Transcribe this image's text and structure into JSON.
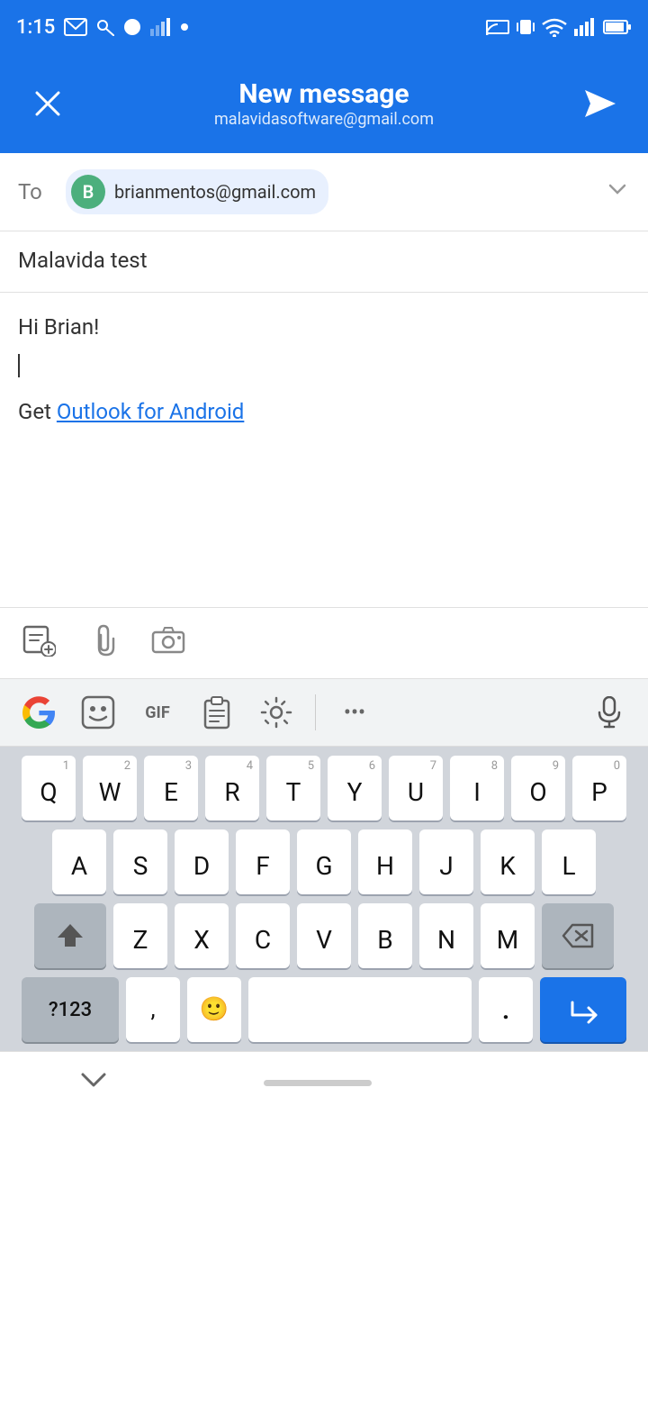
{
  "statusBar": {
    "time": "1:15",
    "icons": [
      "mail",
      "key",
      "circle",
      "signal",
      "dot",
      "cast",
      "vibrate",
      "wifi",
      "signal-bars",
      "battery"
    ]
  },
  "header": {
    "title": "New message",
    "subtitle": "malavidasoftware@gmail.com",
    "closeLabel": "×",
    "sendLabel": "➤"
  },
  "toField": {
    "label": "To",
    "recipientInitial": "B",
    "recipientEmail": "brianmentos@gmail.com"
  },
  "subject": {
    "text": "Malavida test"
  },
  "body": {
    "greeting": "Hi Brian!",
    "signaturePrefix": "Get ",
    "signatureLink": "Outlook for Android"
  },
  "toolbar": {
    "addIcon": "⊞",
    "attachIcon": "📎",
    "cameraIcon": "📷"
  },
  "keyboardTopbar": {
    "gifLabel": "GIF",
    "moreLabel": "•••"
  },
  "keyboard": {
    "row1": [
      {
        "char": "Q",
        "num": "1"
      },
      {
        "char": "W",
        "num": "2"
      },
      {
        "char": "E",
        "num": "3"
      },
      {
        "char": "R",
        "num": "4"
      },
      {
        "char": "T",
        "num": "5"
      },
      {
        "char": "Y",
        "num": "6"
      },
      {
        "char": "U",
        "num": "7"
      },
      {
        "char": "I",
        "num": "8"
      },
      {
        "char": "O",
        "num": "9"
      },
      {
        "char": "P",
        "num": "0"
      }
    ],
    "row2": [
      {
        "char": "A"
      },
      {
        "char": "S"
      },
      {
        "char": "D"
      },
      {
        "char": "F"
      },
      {
        "char": "G"
      },
      {
        "char": "H"
      },
      {
        "char": "J"
      },
      {
        "char": "K"
      },
      {
        "char": "L"
      }
    ],
    "row3": [
      {
        "char": "Z"
      },
      {
        "char": "X"
      },
      {
        "char": "C"
      },
      {
        "char": "V"
      },
      {
        "char": "B"
      },
      {
        "char": "N"
      },
      {
        "char": "M"
      }
    ],
    "symLabel": "?123",
    "commaLabel": ",",
    "emojiLabel": "🙂",
    "periodLabel": "."
  },
  "colors": {
    "headerBg": "#1a73e8",
    "enterBg": "#1a73e8",
    "recipientBg": "#4caf7d"
  }
}
